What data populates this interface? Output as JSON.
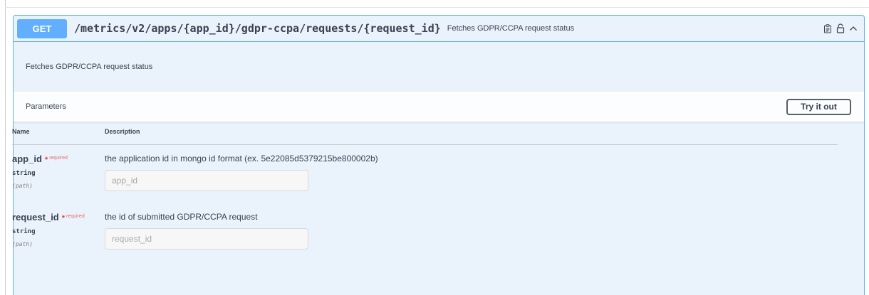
{
  "operation": {
    "method": "GET",
    "path": "/metrics/v2/apps/{app_id}/gdpr-ccpa/requests/{request_id}",
    "summary": "Fetches GDPR/CCPA request status",
    "icons": [
      "clipboard-icon",
      "unlock-icon",
      "chevron-up-icon"
    ]
  },
  "description": "Fetches GDPR/CCPA request status",
  "parameters": {
    "title": "Parameters",
    "try_label": "Try it out",
    "columns": {
      "name": "Name",
      "description": "Description"
    },
    "items": [
      {
        "name": "app_id",
        "star": "*",
        "required": "required",
        "type": "string",
        "in": "(path)",
        "description": "the application id in mongo id format (ex. 5e22085d5379215be800002b)",
        "placeholder": "app_id"
      },
      {
        "name": "request_id",
        "star": "*",
        "required": "required",
        "type": "string",
        "in": "(path)",
        "description": "the id of submitted GDPR/CCPA request",
        "placeholder": "request_id"
      }
    ]
  },
  "colors": {
    "accent": "#61affe",
    "background": "#eaf3fb",
    "required": "#e63e3e"
  }
}
